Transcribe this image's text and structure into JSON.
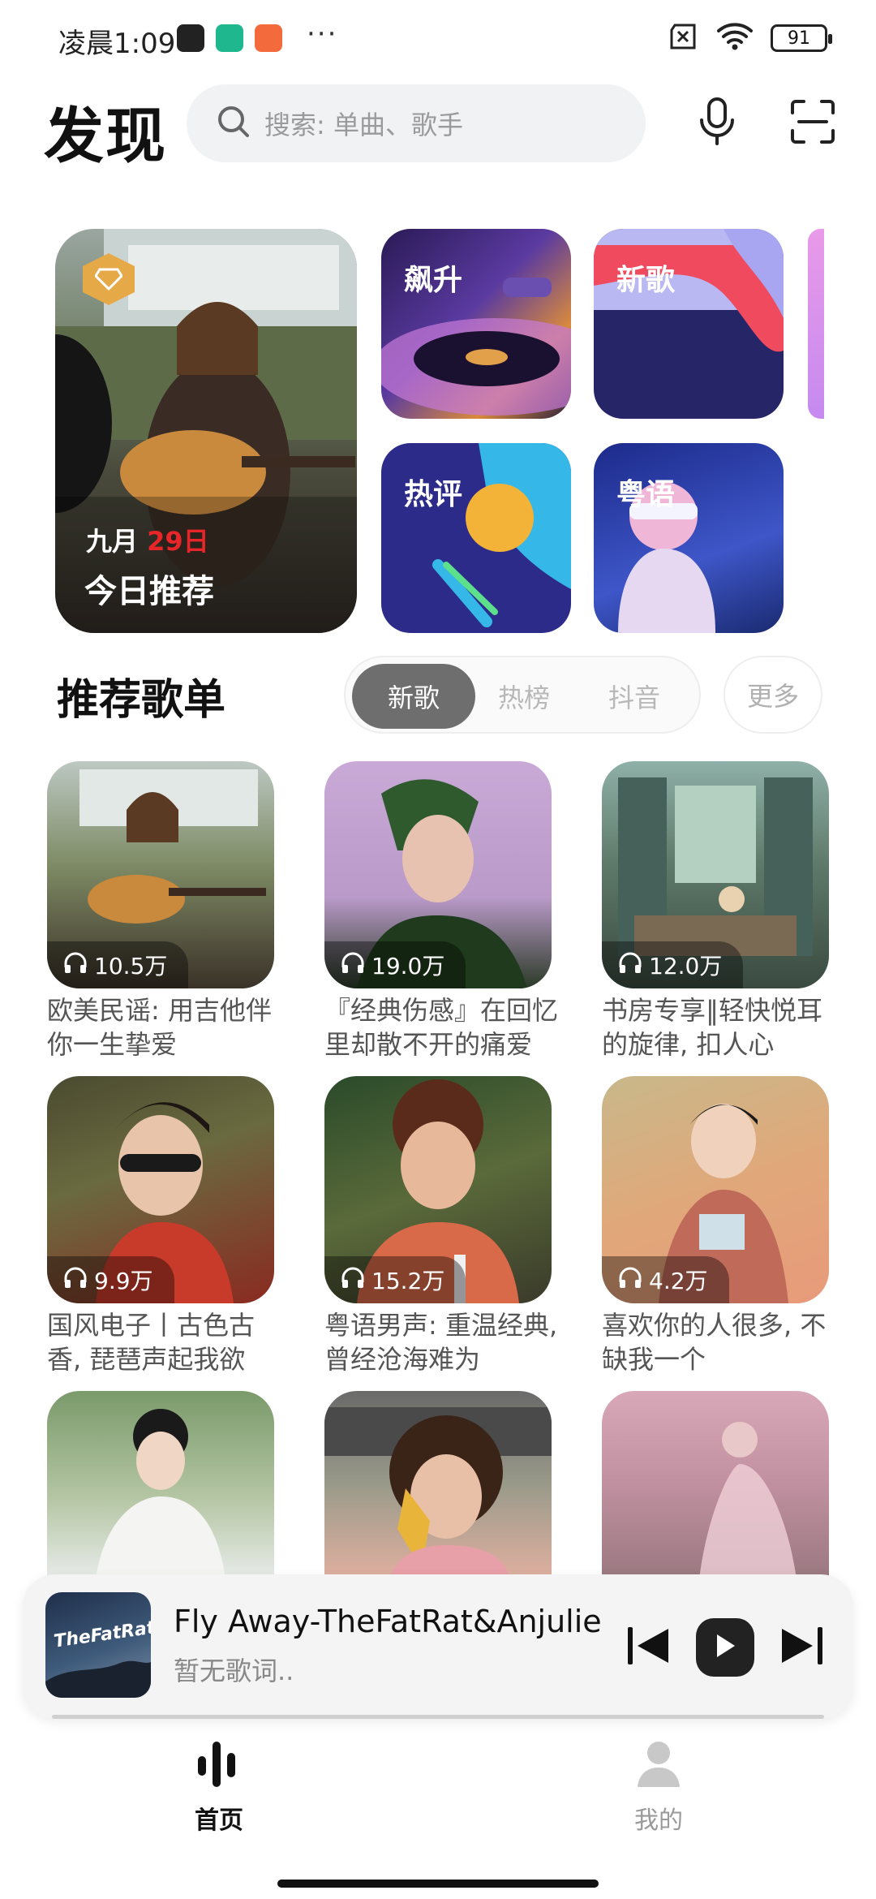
{
  "status_bar": {
    "time": "凌晨1:09",
    "dots": "···",
    "battery": "91"
  },
  "header": {
    "title": "发现",
    "search_placeholder": "搜索: 单曲、歌手",
    "icons": [
      "search-icon",
      "microphone-icon",
      "scan-icon"
    ]
  },
  "featured": {
    "daily": {
      "month": "九月",
      "day": "29日",
      "label": "今日推荐"
    },
    "tiles": [
      {
        "label": "飙升",
        "color": "#3b2a7a"
      },
      {
        "label": "新歌",
        "color": "#2a2a6e"
      },
      {
        "label": "热评",
        "color": "#2d2b8a"
      },
      {
        "label": "粤语",
        "color": "#1f2a7a"
      }
    ]
  },
  "recommend": {
    "title": "推荐歌单",
    "tabs": [
      "新歌",
      "热榜",
      "抖音"
    ],
    "active_tab": "新歌",
    "more": "更多",
    "playlists": [
      {
        "count": "10.5万",
        "title": "欧美民谣: 用吉他伴你一生挚爱"
      },
      {
        "count": "19.0万",
        "title": "『经典伤感』在回忆里却散不开的痛爱"
      },
      {
        "count": "12.0万",
        "title": "书房专享‖轻快悦耳的旋律, 扣人心"
      },
      {
        "count": "9.9万",
        "title": "国风电子丨古色古香, 琵琶声起我欲"
      },
      {
        "count": "15.2万",
        "title": "粤语男声: 重温经典, 曾经沧海难为"
      },
      {
        "count": "4.2万",
        "title": "喜欢你的人很多, 不缺我一个"
      }
    ]
  },
  "player": {
    "title": "Fly Away-TheFatRat&Anjulie",
    "subtitle": "暂无歌词..",
    "cover_text": "TheFatRat",
    "progress": 0.0
  },
  "nav": {
    "home": "首页",
    "mine": "我的"
  },
  "colors": {
    "accent_red": "#e8262a",
    "tab_active": "#6e6e6e"
  }
}
